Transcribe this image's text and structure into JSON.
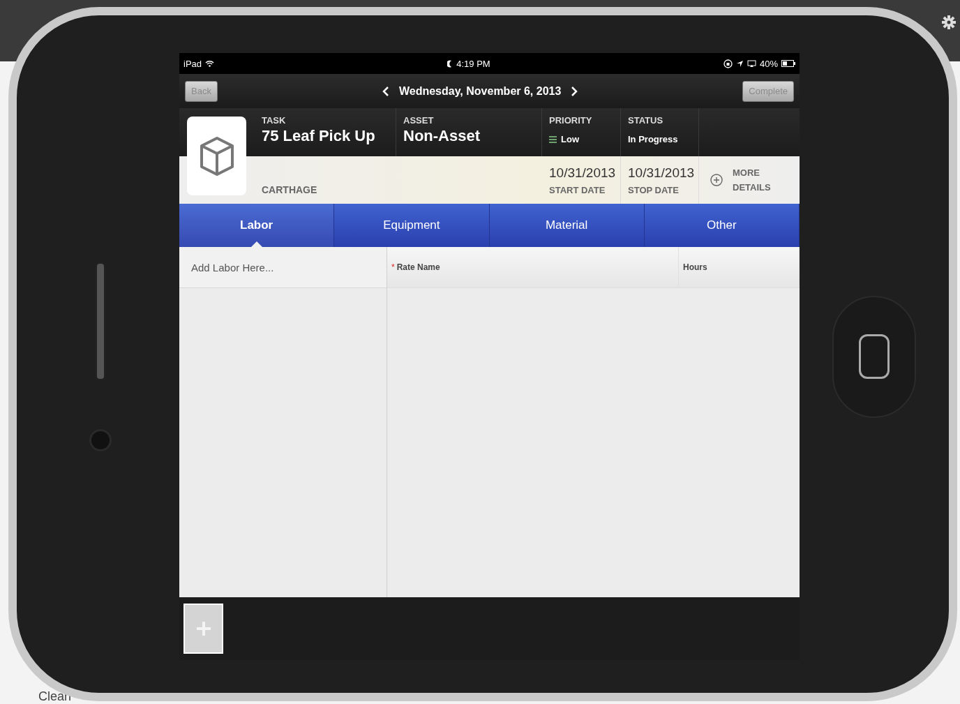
{
  "background": {
    "corner_text": "Clean"
  },
  "status_bar": {
    "carrier": "iPad",
    "time": "4:19 PM",
    "battery": "40%"
  },
  "nav": {
    "back": {
      "label": "Back",
      "disabled": true
    },
    "date": "Wednesday, November 6, 2013",
    "complete": {
      "label": "Complete",
      "disabled": true
    }
  },
  "task": {
    "label": "TASK",
    "name": "75 Leaf Pick Up",
    "location": "CARTHAGE"
  },
  "asset": {
    "label": "ASSET",
    "value": "Non-Asset"
  },
  "priority": {
    "label": "PRIORITY",
    "value": "Low"
  },
  "status": {
    "label": "STATUS",
    "value": "In Progress"
  },
  "dates": [
    {
      "value": "10/31/2013",
      "label": "START DATE"
    },
    {
      "value": "10/31/2013",
      "label": "STOP DATE"
    }
  ],
  "more_details": {
    "line_1": "MORE",
    "line_2": "DETAILS"
  },
  "tabs": [
    {
      "label": "Labor",
      "selected": true
    },
    {
      "label": "Equipment",
      "selected": false
    },
    {
      "label": "Material",
      "selected": false
    },
    {
      "label": "Other",
      "selected": false
    }
  ],
  "labor": {
    "placeholder": "Add Labor Here...",
    "required_mark": "*",
    "columns": [
      {
        "label": "Rate Name",
        "required": true
      },
      {
        "label": "Hours",
        "required": false
      }
    ]
  }
}
